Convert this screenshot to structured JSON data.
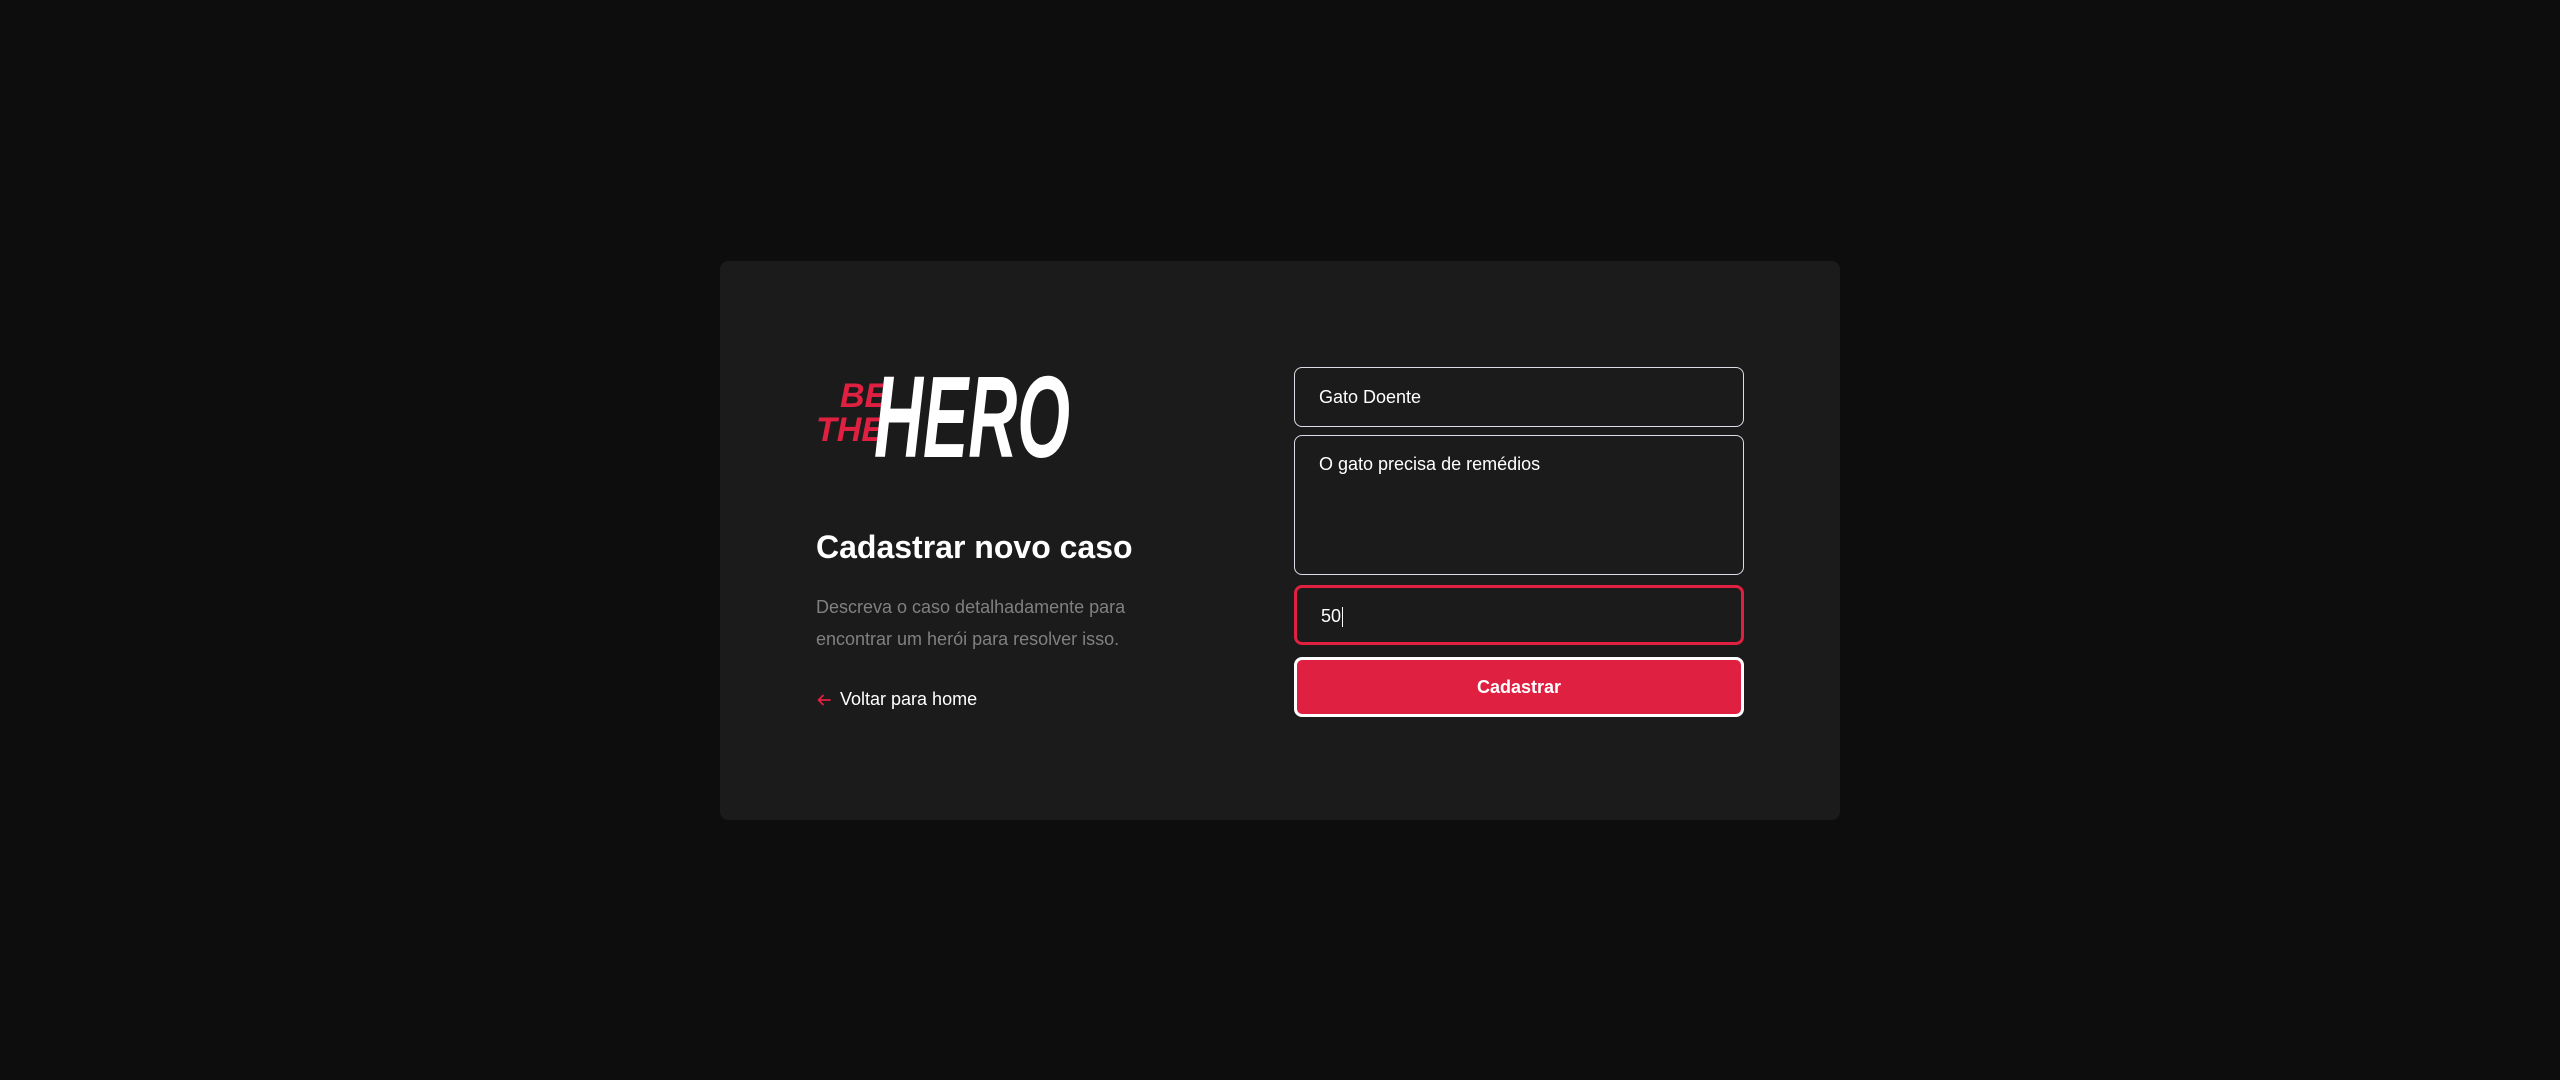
{
  "logo": {
    "line1": "BE",
    "line2": "THE",
    "wordmark": "HERO",
    "accent_color": "#e02041"
  },
  "page": {
    "title": "Cadastrar novo caso",
    "description": "Descreva o caso detalhadamente para encontrar um herói para resolver isso.",
    "back_link_label": "Voltar para home",
    "back_icon": "arrow-left-icon"
  },
  "form": {
    "title_value": "Gato Doente",
    "description_value": "O gato precisa de remédios",
    "value_value": "50",
    "submit_label": "Cadastrar"
  },
  "colors": {
    "background": "#0d0d0d",
    "card": "#1b1b1b",
    "accent": "#e02041",
    "muted_text": "#808080"
  }
}
